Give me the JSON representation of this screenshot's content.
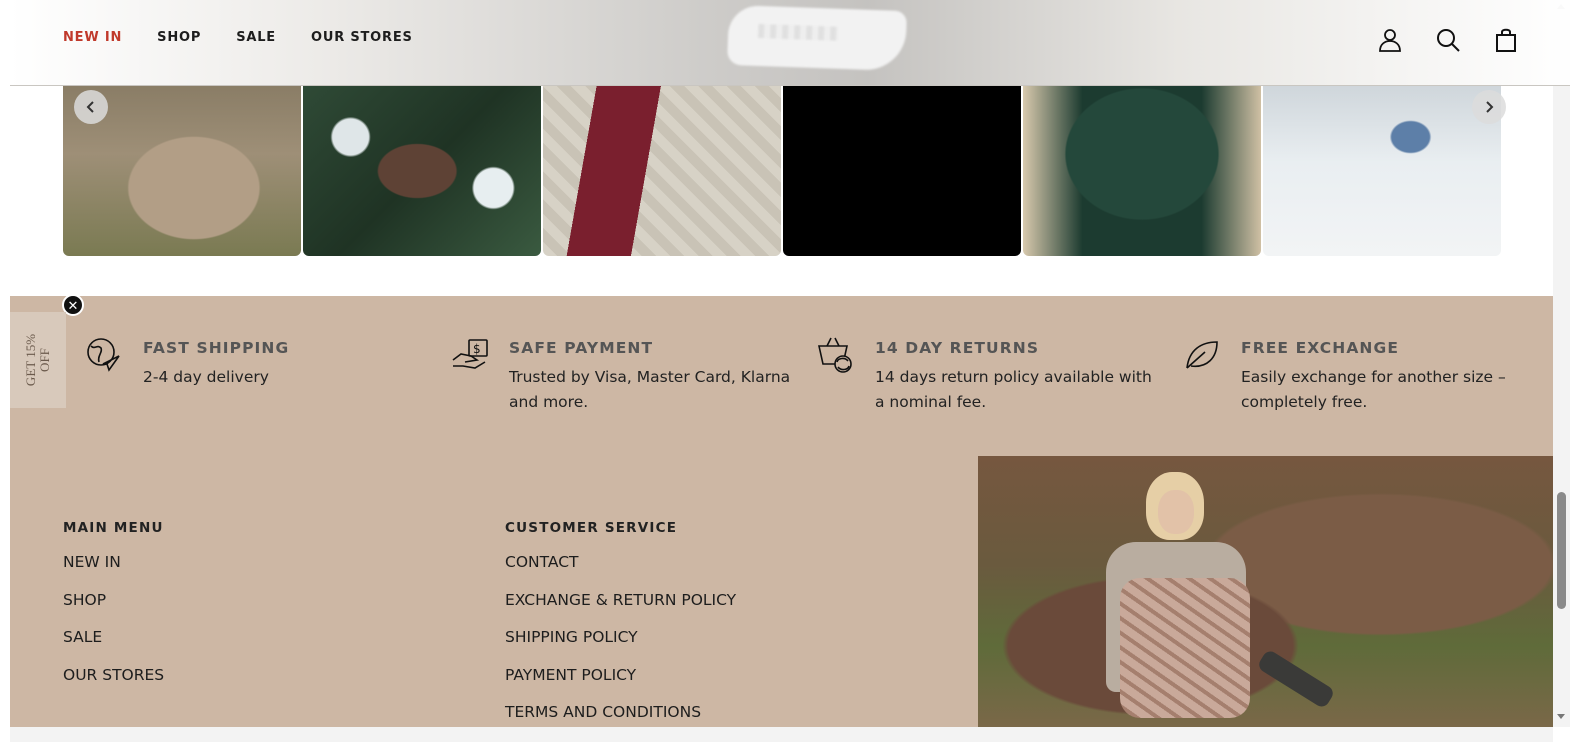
{
  "header": {
    "nav": [
      {
        "label": "NEW IN",
        "active": true
      },
      {
        "label": "SHOP"
      },
      {
        "label": "SALE"
      },
      {
        "label": "OUR STORES"
      }
    ],
    "icons": [
      "account-icon",
      "search-icon",
      "cart-bag-icon"
    ],
    "accent_color": "#c0392b"
  },
  "carousel": {
    "slides": [
      "knit-cardigan-photo",
      "brown-coat-in-snow-photo",
      "lace-jacket-photo",
      "black-video-slide",
      "green-dress-with-glass-photo",
      "snow-walk-photo"
    ],
    "prev_icon": "chevron-left-icon",
    "next_icon": "chevron-right-icon"
  },
  "promo": {
    "side_tab": "GET 15% OFF",
    "close_icon": "close-icon"
  },
  "features": [
    {
      "icon": "globe-plane-icon",
      "title": "FAST SHIPPING",
      "desc": "2-4 day delivery"
    },
    {
      "icon": "hand-money-icon",
      "title": "SAFE PAYMENT",
      "desc": "Trusted by Visa, Master Card, Klarna and more."
    },
    {
      "icon": "basket-refresh-icon",
      "title": "14 DAY RETURNS",
      "desc": "14 days return policy available with a nominal fee."
    },
    {
      "icon": "leaf-icon",
      "title": "FREE EXCHANGE",
      "desc": "Easily exchange for another size – completely free."
    }
  ],
  "footer": {
    "main_menu": {
      "title": "MAIN MENU",
      "links": [
        "NEW IN",
        "SHOP",
        "SALE",
        "OUR STORES"
      ]
    },
    "customer_service": {
      "title": "CUSTOMER SERVICE",
      "links": [
        "CONTACT",
        "EXCHANGE & RETURN POLICY",
        "SHIPPING POLICY",
        "PAYMENT POLICY",
        "TERMS AND CONDITIONS"
      ]
    },
    "background_color": "#cdb7a4"
  }
}
